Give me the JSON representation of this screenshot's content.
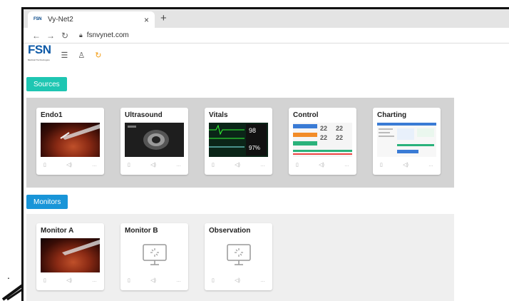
{
  "browser": {
    "tab_title": "Vy-Net2",
    "tab_favicon": "FSN",
    "tab_close": "×",
    "new_tab": "+",
    "url": "fsnvynet.com"
  },
  "app": {
    "logo": "FSN",
    "logo_sub": "Medical Technologies",
    "accent_sources": "#1ec6b2",
    "accent_monitors": "#1995d8"
  },
  "sources": {
    "label": "Sources",
    "cards": [
      {
        "title": "Endo1"
      },
      {
        "title": "Ultrasound"
      },
      {
        "title": "Vitals",
        "readouts": [
          "98",
          "97%"
        ]
      },
      {
        "title": "Control",
        "readouts": [
          "22",
          "22",
          "22",
          "22"
        ]
      },
      {
        "title": "Charting"
      }
    ]
  },
  "monitors": {
    "label": "Monitors",
    "cards": [
      {
        "title": "Monitor A"
      },
      {
        "title": "Monitor B"
      },
      {
        "title": "Observation"
      }
    ]
  }
}
